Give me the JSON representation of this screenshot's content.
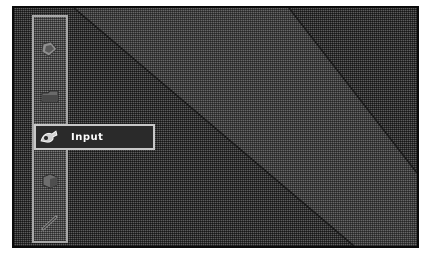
{
  "menu": {
    "items": [
      {
        "icon": "picture-icon",
        "label": "",
        "selected": false
      },
      {
        "icon": "tray-icon",
        "label": "",
        "selected": false
      },
      {
        "icon": "input-icon",
        "label": "Input",
        "selected": true
      },
      {
        "icon": "box-icon",
        "label": "",
        "selected": false
      },
      {
        "icon": "wrench-icon",
        "label": "",
        "selected": false
      }
    ]
  }
}
